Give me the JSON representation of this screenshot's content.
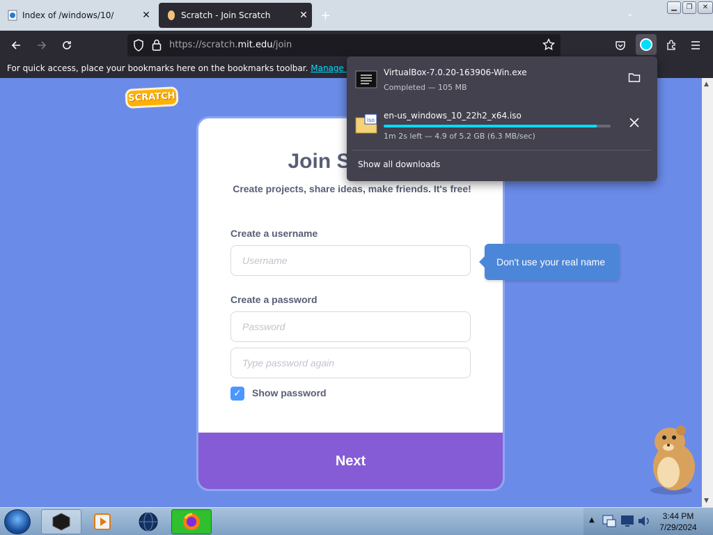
{
  "browser": {
    "tabs": [
      {
        "title": "Index of /windows/10/",
        "active": false
      },
      {
        "title": "Scratch - Join Scratch",
        "active": true
      }
    ],
    "url_prefix": "https://scratch.",
    "url_domain": "mit.edu",
    "url_suffix": "/join",
    "bookmarks_hint": "For quick access, place your bookmarks here on the bookmarks toolbar.",
    "bookmarks_link": "Manage bookmarks..."
  },
  "downloads": {
    "items": [
      {
        "name": "VirtualBox-7.0.20-163906-Win.exe",
        "status": "Completed — 105 MB",
        "icon": "exe-file-icon"
      },
      {
        "name": "en-us_windows_10_22h2_x64.iso",
        "status": "1m 2s left — 4.9 of 5.2 GB (6.3 MB/sec)",
        "icon": "iso-file-icon",
        "progress": 0.94
      }
    ],
    "show_all": "Show all downloads"
  },
  "page": {
    "logo_text": "SCRATCH",
    "title": "Join Scratch",
    "subtitle": "Create projects, share ideas, make friends. It's free!",
    "username_label": "Create a username",
    "username_placeholder": "Username",
    "password_label": "Create a password",
    "password_placeholder": "Password",
    "password_again_placeholder": "Type password again",
    "show_password_label": "Show password",
    "show_password_checked": true,
    "next_label": "Next",
    "tooltip": "Don't use your real name"
  },
  "taskbar": {
    "time": "3:44 PM",
    "date": "7/29/2024"
  },
  "colors": {
    "page_bg": "#6b8be8",
    "next_button": "#855cd6",
    "tooltip": "#4c86d9",
    "checkbox": "#4c97ff",
    "progress": "#00ddff"
  }
}
